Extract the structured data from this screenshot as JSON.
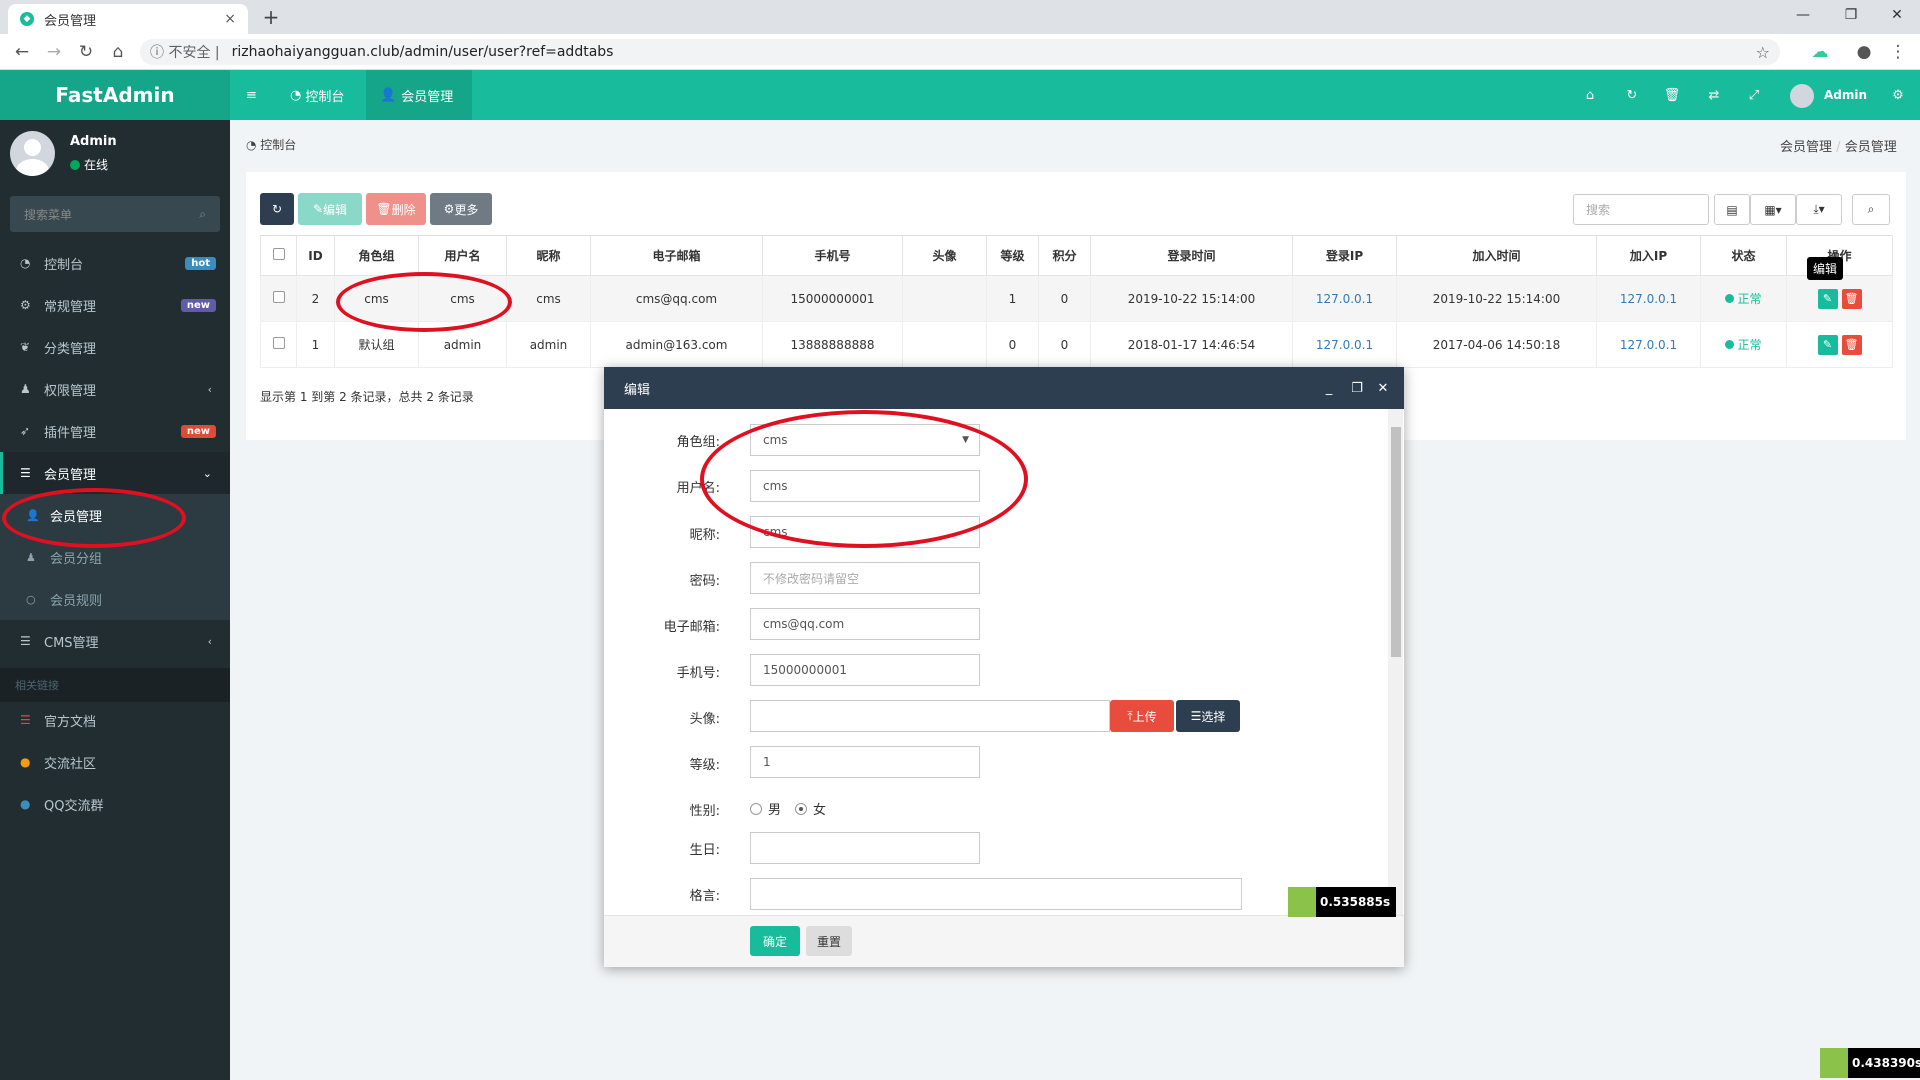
{
  "browser": {
    "tab_title": "会员管理",
    "tab_close": "×",
    "new_tab": "+",
    "security_label": "不安全",
    "url": "rizhaohaiyangguan.club/admin/user/user?ref=addtabs",
    "window_controls": [
      "—",
      "❐",
      "✕"
    ]
  },
  "header": {
    "logo": "FastAdmin",
    "tabs": [
      {
        "label": "控制台",
        "icon": "dashboard-icon"
      },
      {
        "label": "会员管理",
        "icon": "user-icon"
      }
    ],
    "user": "Admin"
  },
  "sidebar": {
    "user_name": "Admin",
    "user_status": "在线",
    "search_placeholder": "搜索菜单",
    "items": [
      {
        "label": "控制台",
        "icon": "dashboard-icon",
        "badge": "hot",
        "badge_color": "#3c8dbc"
      },
      {
        "label": "常规管理",
        "icon": "cogs-icon",
        "badge": "new",
        "badge_color": "#605ca8"
      },
      {
        "label": "分类管理",
        "icon": "leaf-icon"
      },
      {
        "label": "权限管理",
        "icon": "group-icon",
        "arrow": "‹"
      },
      {
        "label": "插件管理",
        "icon": "rocket-icon",
        "badge": "new",
        "badge_color": "#dd4b39"
      },
      {
        "label": "会员管理",
        "icon": "list-icon",
        "arrow": "⌄"
      }
    ],
    "sub_items": [
      {
        "label": "会员管理",
        "icon": "user-icon"
      },
      {
        "label": "会员分组",
        "icon": "users-icon"
      },
      {
        "label": "会员规则",
        "icon": "circle-icon"
      }
    ],
    "cms": {
      "label": "CMS管理",
      "arrow": "‹"
    },
    "section_header": "相关链接",
    "links": [
      {
        "label": "官方文档",
        "icon": "list-icon",
        "color": "#dd4b39"
      },
      {
        "label": "交流社区",
        "icon": "comment-icon",
        "color": "#f39c12"
      },
      {
        "label": "QQ交流群",
        "icon": "qq-icon",
        "color": "#3c8dbc"
      }
    ]
  },
  "breadcrumb": {
    "left": "控制台",
    "right": [
      "会员管理",
      "/",
      "会员管理"
    ]
  },
  "toolbar": {
    "edit": "编辑",
    "delete": "删除",
    "more": "更多",
    "search_placeholder": "搜索"
  },
  "table": {
    "columns": [
      "ID",
      "角色组",
      "用户名",
      "昵称",
      "电子邮箱",
      "手机号",
      "头像",
      "等级",
      "积分",
      "登录时间",
      "登录IP",
      "加入时间",
      "加入IP",
      "状态",
      "操作"
    ],
    "rows": [
      {
        "id": "2",
        "group": "cms",
        "username": "cms",
        "nickname": "cms",
        "email": "cms@qq.com",
        "mobile": "15000000001",
        "avatar": "",
        "level": "1",
        "score": "0",
        "login_time": "2019-10-22 15:14:00",
        "login_ip": "127.0.0.1",
        "join_time": "2019-10-22 15:14:00",
        "join_ip": "127.0.0.1",
        "status": "正常"
      },
      {
        "id": "1",
        "group": "默认组",
        "username": "admin",
        "nickname": "admin",
        "email": "admin@163.com",
        "mobile": "13888888888",
        "avatar": "",
        "level": "0",
        "score": "0",
        "login_time": "2018-01-17 14:46:54",
        "login_ip": "127.0.0.1",
        "join_time": "2017-04-06 14:50:18",
        "join_ip": "127.0.0.1",
        "status": "正常"
      }
    ],
    "tooltip": "编辑",
    "pager_text": "显示第 1 到第 2 条记录，总共 2 条记录"
  },
  "modal": {
    "title": "编辑",
    "fields": [
      {
        "label": "角色组:",
        "value": "cms"
      },
      {
        "label": "用户名:",
        "value": "cms"
      },
      {
        "label": "昵称:",
        "value": "cms"
      },
      {
        "label": "密码:",
        "placeholder": "不修改密码请留空"
      },
      {
        "label": "电子邮箱:",
        "value": "cms@qq.com"
      },
      {
        "label": "手机号:",
        "value": "15000000001"
      },
      {
        "label": "头像:",
        "value": ""
      },
      {
        "label": "等级:",
        "value": "1"
      },
      {
        "label": "性别:",
        "value": ""
      },
      {
        "label": "生日:",
        "value": ""
      },
      {
        "label": "格言:",
        "value": ""
      }
    ],
    "upload": "上传",
    "choose": "选择",
    "gender_male": "男",
    "gender_female": "女",
    "confirm": "确定",
    "reset": "重置"
  },
  "timers": [
    "0.535885s",
    "0.438390s"
  ]
}
